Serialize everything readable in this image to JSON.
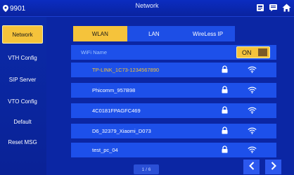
{
  "header": {
    "room_number": "9901",
    "title": "Network",
    "icons": [
      "book-icon",
      "message-icon",
      "home-icon"
    ]
  },
  "sidebar": {
    "items": [
      {
        "label": "Network",
        "active": true
      },
      {
        "label": "VTH Config",
        "active": false
      },
      {
        "label": "SIP Server",
        "active": false
      },
      {
        "label": "VTO Config",
        "active": false
      },
      {
        "label": "Default",
        "active": false
      },
      {
        "label": "Reset MSG",
        "active": false
      }
    ]
  },
  "tabs": [
    {
      "label": "WLAN",
      "active": true
    },
    {
      "label": "LAN",
      "active": false
    },
    {
      "label": "WireLess IP",
      "active": false
    }
  ],
  "wifi": {
    "header_label": "WiFi Name",
    "toggle_label": "ON",
    "networks": [
      {
        "ssid": "TP-LINK_1C73-1234567890",
        "selected": true,
        "locked": true
      },
      {
        "ssid": "Phicomm_957B98",
        "selected": false,
        "locked": true
      },
      {
        "ssid": "4C0181FPAGFC469",
        "selected": false,
        "locked": true
      },
      {
        "ssid": "D6_32379_Xiaomi_D073",
        "selected": false,
        "locked": true
      },
      {
        "ssid": "test_pc_04",
        "selected": false,
        "locked": true
      }
    ]
  },
  "pagination": {
    "page": "1 / 6"
  },
  "colors": {
    "accent": "#f5c33b",
    "row_bg": "#1d50ea",
    "background": "#0a1f8f"
  }
}
